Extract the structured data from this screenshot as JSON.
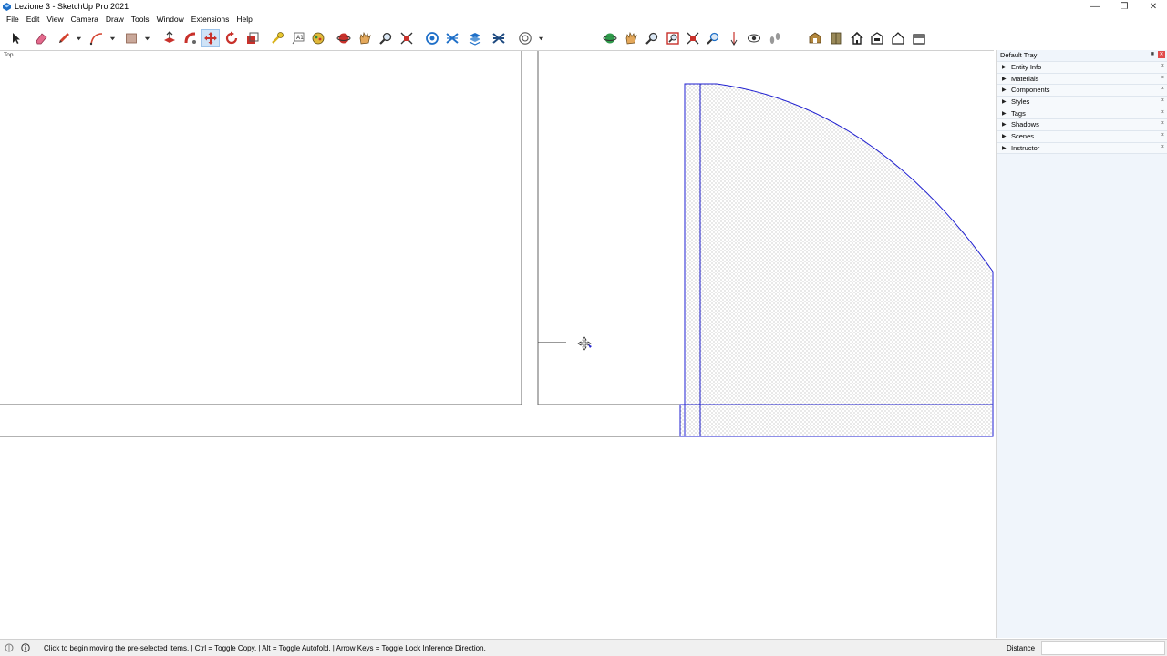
{
  "window": {
    "title": "Lezione 3 - SketchUp Pro 2021",
    "minimize_icon": "minimize-icon",
    "restore_icon": "restore-icon",
    "close_icon": "close-icon"
  },
  "menu": [
    "File",
    "Edit",
    "View",
    "Camera",
    "Draw",
    "Tools",
    "Window",
    "Extensions",
    "Help"
  ],
  "toolbar": {
    "active_tool": "move-tool",
    "tools": [
      "select",
      "eraser",
      "pencil",
      "line-dropdown",
      "arc",
      "arc-dropdown",
      "shape",
      "shape-dropdown",
      "push-pull",
      "follow-me",
      "move",
      "rotate",
      "scale",
      "tape-measure",
      "text",
      "paint-bucket",
      "orbit",
      "pan",
      "zoom",
      "zoom-extents",
      "section-plane",
      "section-fill",
      "section-cuts",
      "solid-tools",
      "extensions-menu",
      "extensions-dropdown",
      "orbit-2",
      "walk",
      "zoom-2",
      "zoom-window",
      "zoom-extents-2",
      "position-camera",
      "look-around",
      "position-camera-2",
      "footprints",
      "3d-warehouse",
      "extension-warehouse",
      "home",
      "layout",
      "house",
      "house-outline"
    ]
  },
  "viewport": {
    "label": "Top",
    "cursor": "move-cursor-icon"
  },
  "tray": {
    "title": "Default Tray",
    "pin_icon": "pin-icon",
    "close_icon": "close-icon",
    "panels": [
      {
        "label": "Entity Info"
      },
      {
        "label": "Materials"
      },
      {
        "label": "Components"
      },
      {
        "label": "Styles"
      },
      {
        "label": "Tags"
      },
      {
        "label": "Shadows"
      },
      {
        "label": "Scenes"
      },
      {
        "label": "Instructor"
      }
    ]
  },
  "status": {
    "text": "Click to begin moving the pre-selected items. | Ctrl = Toggle Copy. | Alt = Toggle Autofold. | Arrow Keys = Toggle Lock Inference Direction.",
    "measurement_label": "Distance",
    "measurement_value": ""
  },
  "colors": {
    "selection_blue": "#1f1fd0",
    "edge_gray": "#666666",
    "tray_bg": "#f0f5fb",
    "active_tool_bg": "#cfe3f7"
  }
}
